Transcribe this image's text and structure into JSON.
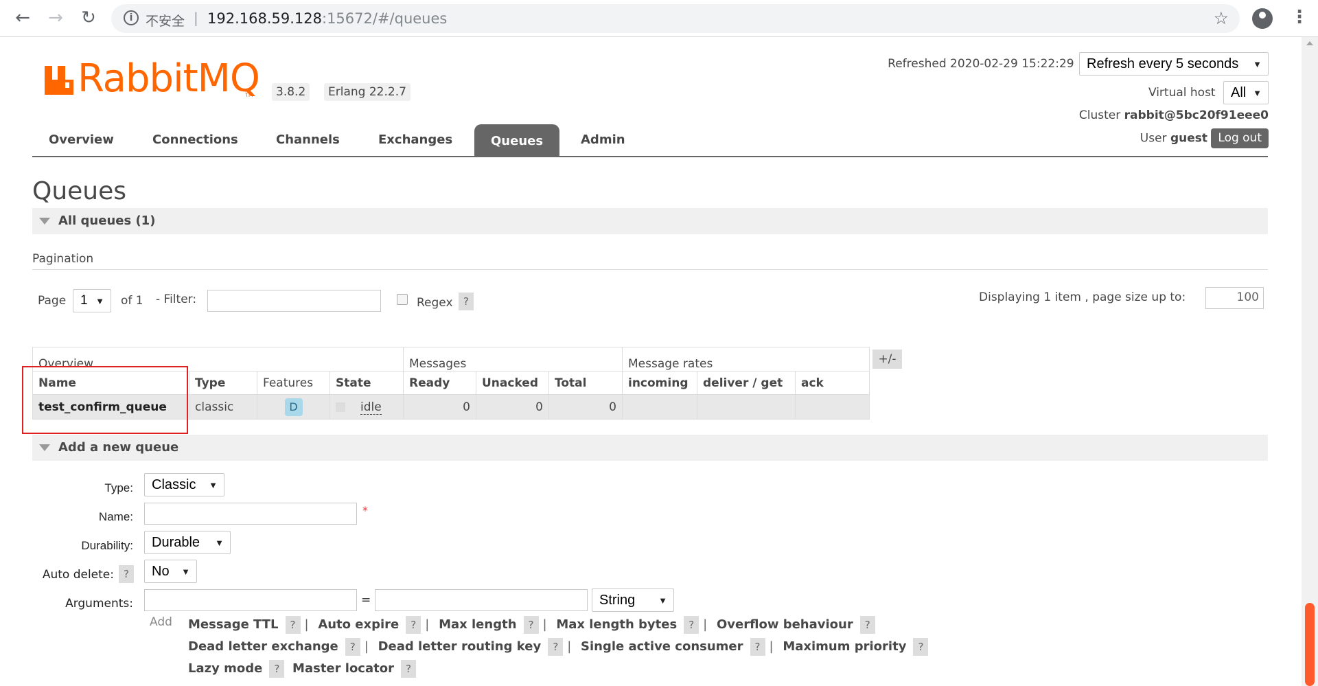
{
  "browser": {
    "security_label": "不安全",
    "url_host": "192.168.59.128",
    "url_rest": ":15672/#/queues"
  },
  "header": {
    "logo_text": "RabbitMQ",
    "version": "3.8.2",
    "erlang": "Erlang 22.2.7",
    "refreshed_label": "Refreshed",
    "refreshed_time": "2020-02-29 15:22:29",
    "refresh_select": "Refresh every 5 seconds",
    "vhost_label": "Virtual host",
    "vhost_select": "All",
    "cluster_label": "Cluster",
    "cluster_name": "rabbit@5bc20f91eee0",
    "user_label": "User",
    "user_name": "guest",
    "logout_label": "Log out"
  },
  "tabs": [
    {
      "label": "Overview"
    },
    {
      "label": "Connections"
    },
    {
      "label": "Channels"
    },
    {
      "label": "Exchanges"
    },
    {
      "label": "Queues",
      "active": true
    },
    {
      "label": "Admin"
    }
  ],
  "page": {
    "title": "Queues",
    "all_queues_label": "All queues (1)",
    "pagination_label": "Pagination"
  },
  "pagination": {
    "page_label": "Page",
    "page_value": "1",
    "of_label": "of 1",
    "filter_label": "- Filter:",
    "regex_label": "Regex",
    "help": "?",
    "displaying_label": "Displaying 1 item , page size up to:",
    "page_size": "100"
  },
  "table": {
    "groups": [
      "Overview",
      "Messages",
      "Message rates"
    ],
    "columns": [
      "Name",
      "Type",
      "Features",
      "State",
      "Ready",
      "Unacked",
      "Total",
      "incoming",
      "deliver / get",
      "ack"
    ],
    "plusminus": "+/-",
    "rows": [
      {
        "name": "test_confirm_queue",
        "type": "classic",
        "feature": "D",
        "state": "idle",
        "ready": "0",
        "unacked": "0",
        "total": "0",
        "incoming": "",
        "deliver_get": "",
        "ack": ""
      }
    ]
  },
  "add_queue": {
    "section_label": "Add a new queue",
    "type_label": "Type:",
    "type_value": "Classic",
    "name_label": "Name:",
    "required_mark": "*",
    "durability_label": "Durability:",
    "durability_value": "Durable",
    "auto_delete_label": "Auto delete:",
    "auto_delete_value": "No",
    "arguments_label": "Arguments:",
    "equals": "=",
    "arg_type_value": "String",
    "add_label": "Add",
    "args_row1": [
      "Message TTL",
      "Auto expire",
      "Max length",
      "Max length bytes",
      "Overflow behaviour"
    ],
    "args_row2": [
      "Dead letter exchange",
      "Dead letter routing key",
      "Single active consumer",
      "Maximum priority"
    ],
    "args_row3": [
      "Lazy mode",
      "Master locator"
    ]
  },
  "colors": {
    "brand": "#ff6600",
    "tab_active": "#666666",
    "highlight": "#e02020"
  }
}
